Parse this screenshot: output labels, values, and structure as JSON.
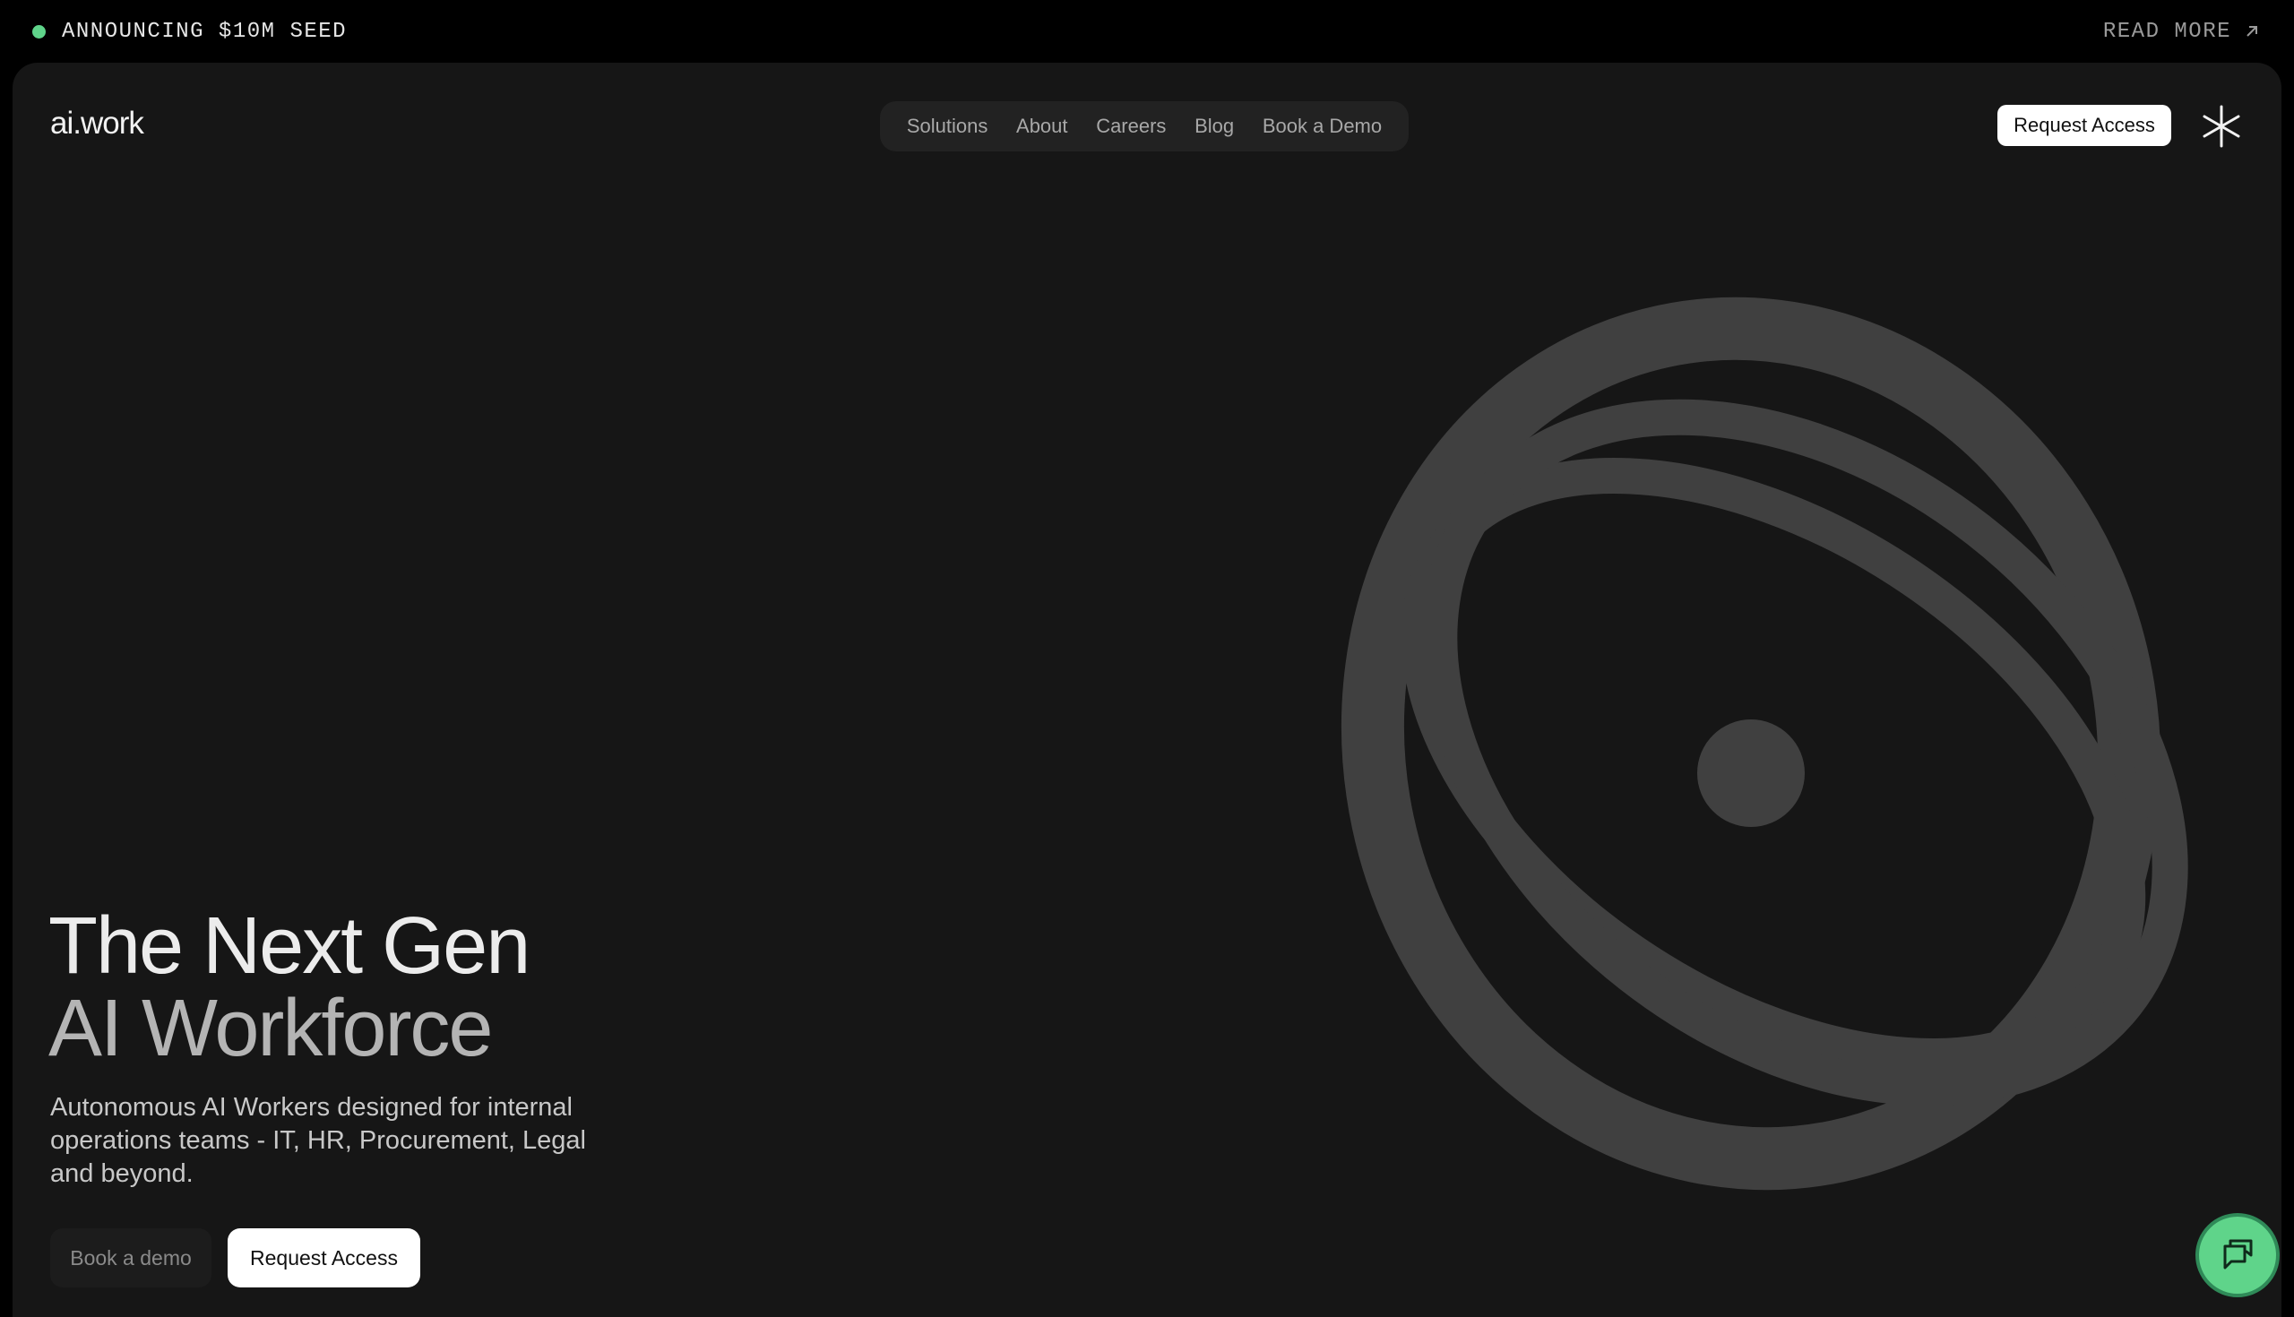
{
  "announcement": {
    "text": "ANNOUNCING $10M SEED",
    "link_label": "READ MORE",
    "status_color": "#5fd48a"
  },
  "header": {
    "logo_text": "ai.work",
    "nav": [
      {
        "label": "Solutions"
      },
      {
        "label": "About"
      },
      {
        "label": "Careers"
      },
      {
        "label": "Blog"
      },
      {
        "label": "Book a Demo"
      }
    ],
    "cta_label": "Request Access",
    "menu_icon": "asterisk-icon"
  },
  "hero": {
    "title_line1": "The Next Gen",
    "title_line2": "AI Workforce",
    "subtitle": "Autonomous AI Workers designed for internal operations teams - IT, HR, Procurement, Legal and beyond.",
    "secondary_button": "Book a demo",
    "primary_button": "Request Access"
  },
  "chat_widget": {
    "icon": "chat-icon",
    "color": "#5fd48a"
  },
  "colors": {
    "background": "#000000",
    "panel": "#161616",
    "art": "#404040",
    "accent": "#5fd48a"
  }
}
